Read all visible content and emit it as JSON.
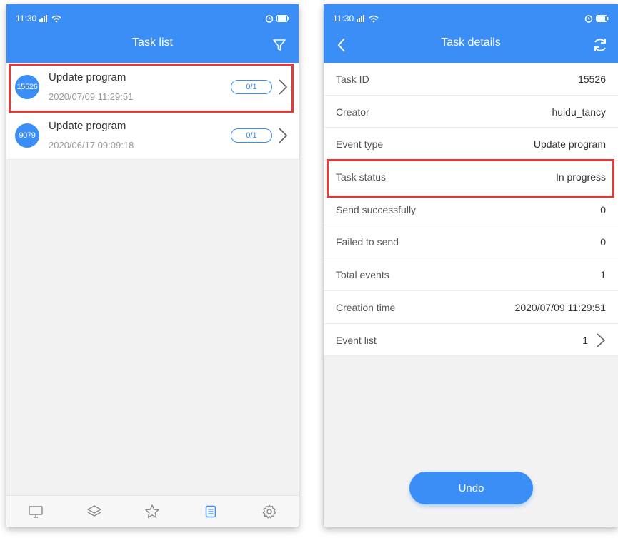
{
  "left_screen": {
    "status_time": "11:30",
    "title": "Task list",
    "filter_icon": "filter-icon",
    "tasks": [
      {
        "id": "15526",
        "name": "Update program",
        "time": "2020/07/09 11:29:51",
        "progress": "0/1"
      },
      {
        "id": "9079",
        "name": "Update program",
        "time": "2020/06/17 09:09:18",
        "progress": "0/1"
      }
    ],
    "nav_icons": [
      "monitor-icon",
      "layers-icon",
      "star-icon",
      "task-list-icon",
      "settings-icon"
    ],
    "nav_active_index": 3
  },
  "right_screen": {
    "status_time": "11:30",
    "title": "Task details",
    "fields": [
      {
        "label": "Task ID",
        "value": "15526"
      },
      {
        "label": "Creator",
        "value": "huidu_tancy"
      },
      {
        "label": "Event type",
        "value": "Update program"
      },
      {
        "label": "Task status",
        "value": "In progress"
      },
      {
        "label": "Send successfully",
        "value": "0"
      },
      {
        "label": "Failed to send",
        "value": "0"
      },
      {
        "label": "Total events",
        "value": "1"
      },
      {
        "label": "Creation time",
        "value": "2020/07/09 11:29:51"
      },
      {
        "label": "Event list",
        "value": "1"
      }
    ],
    "undo_label": "Undo"
  },
  "colors": {
    "primary": "#3a8ef6",
    "highlight": "#e53935",
    "inactive_icon": "#888888"
  }
}
